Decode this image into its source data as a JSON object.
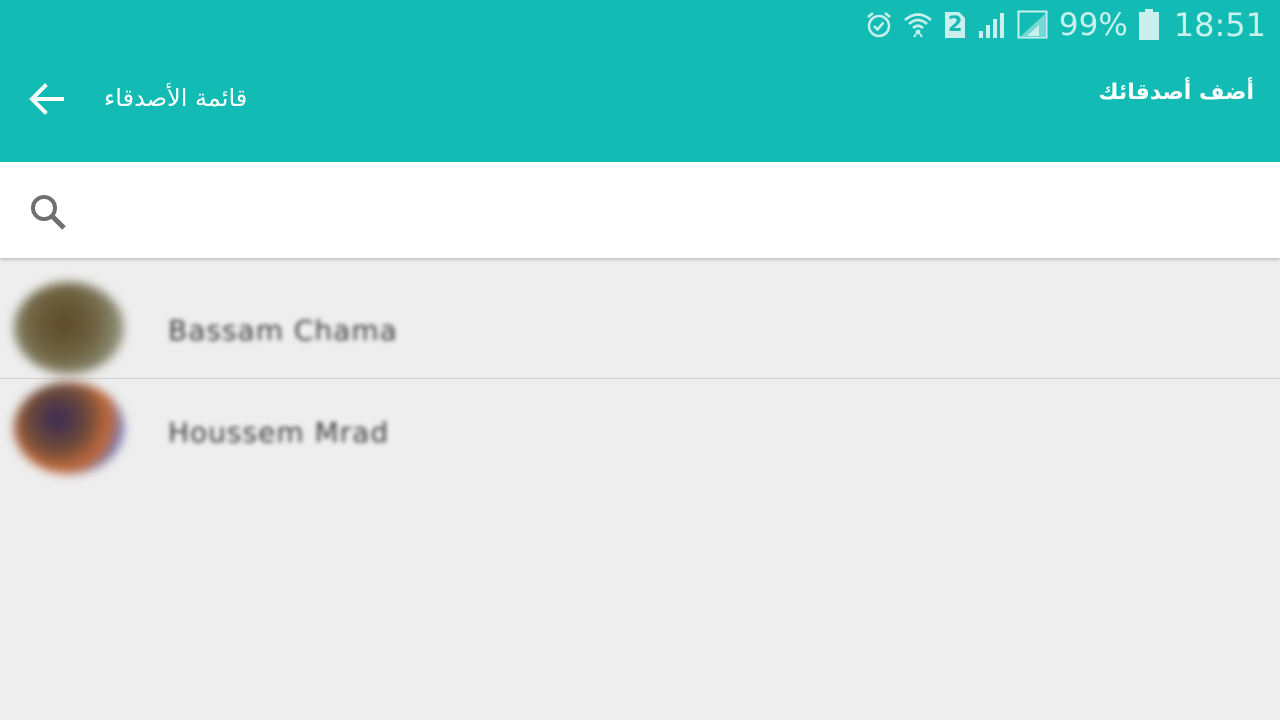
{
  "status_bar": {
    "battery_percent_text": "99%",
    "time": "18:51",
    "sim_label": "2",
    "battery_level": 0.99,
    "icons": [
      "alarm-icon",
      "wifi-icon",
      "sim-2-icon",
      "signal-icon",
      "signal-2-icon",
      "battery-icon"
    ]
  },
  "app_bar": {
    "title": "قائمة الأصدقاء",
    "action_label": "أضف أصدقائك",
    "back_icon": "arrow-back-icon",
    "background_color": "#12bbb3"
  },
  "search": {
    "placeholder": "",
    "value": "",
    "icon": "search-icon"
  },
  "friends": [
    {
      "name": "Bassam Chama"
    },
    {
      "name": "Houssem Mrad"
    }
  ],
  "colors": {
    "accent": "#12bbb3",
    "background": "#eeeeee",
    "status_icon": "#c9f0ec"
  }
}
